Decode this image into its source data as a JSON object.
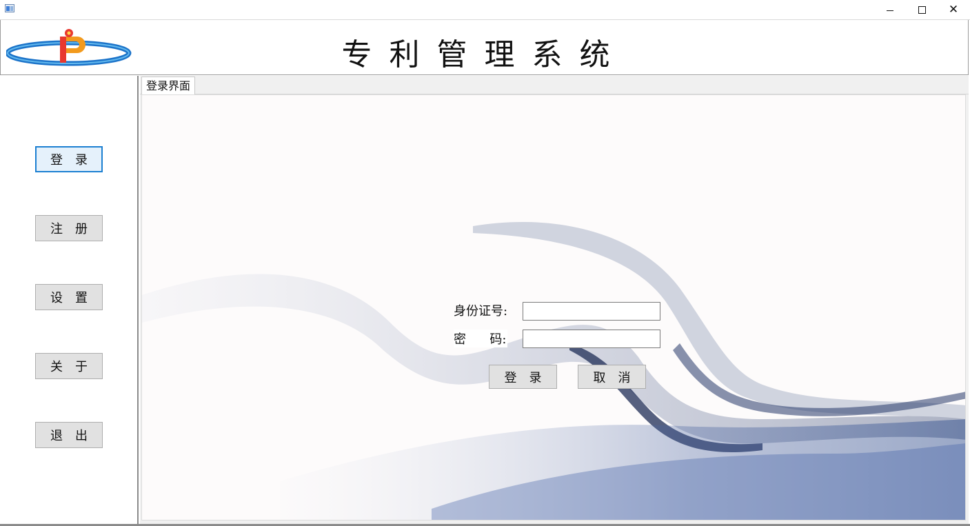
{
  "window": {
    "icon": "window-app-icon",
    "controls": {
      "minimize": "minimize-icon",
      "maximize": "maximize-icon",
      "close": "close-icon"
    },
    "close_glyph": "✕"
  },
  "header": {
    "logo": "ip-logo",
    "title": "专利管理系统"
  },
  "sidebar": {
    "items": [
      {
        "label": "登录"
      },
      {
        "label": "注册"
      },
      {
        "label": "设置"
      },
      {
        "label": "关于"
      },
      {
        "label": "退出"
      }
    ]
  },
  "tabs": [
    {
      "label": "登录界面"
    }
  ],
  "login_form": {
    "id_label": "身份证号:",
    "password_label": "密      码:",
    "id_value": "",
    "password_value": "",
    "login_button": "登录",
    "cancel_button": "取消"
  },
  "colors": {
    "accent": "#1b7fd1",
    "button_face": "#e1e1e1",
    "smoke_dark": "#2b3d6b",
    "smoke_light": "#c7cede"
  }
}
